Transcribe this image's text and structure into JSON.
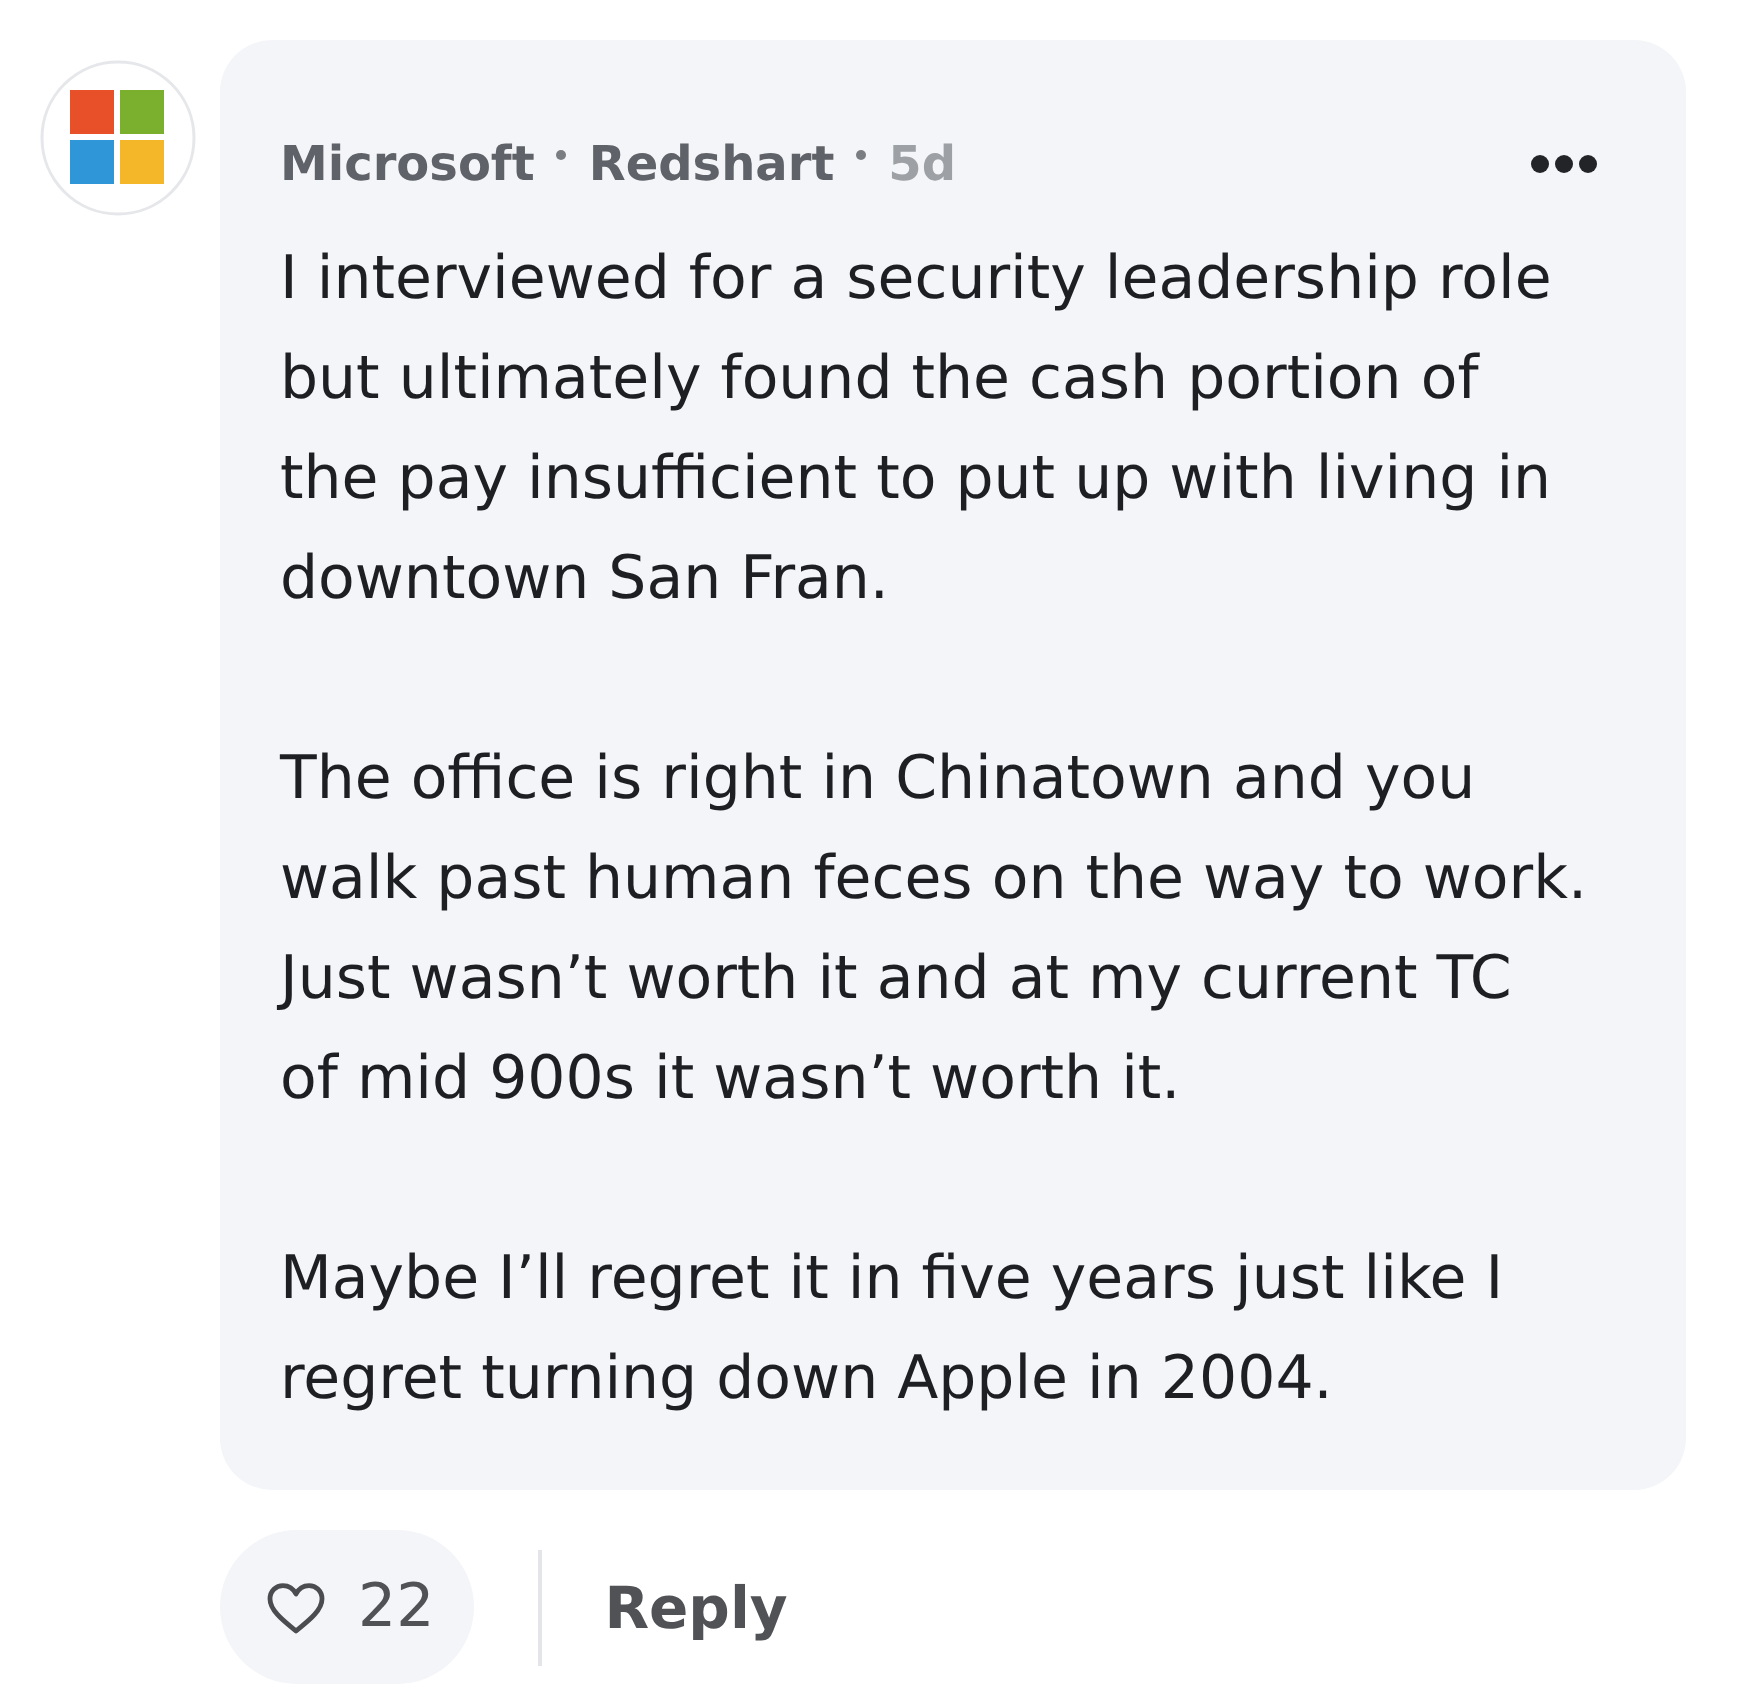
{
  "comment": {
    "author": {
      "company": "Microsoft",
      "username": "Redshart",
      "age": "5d"
    },
    "paragraphs": [
      [
        "I interviewed for a security leadership role",
        "but ultimately found the cash portion of",
        "the pay insufficient to put up with living in",
        "downtown San Fran."
      ],
      [
        "The office is right in Chinatown and you",
        "walk past human feces on the way to work.",
        "Just wasn’t worth it and at my current TC",
        "of mid 900s it wasn’t worth it."
      ],
      [
        "Maybe I’ll regret it in five years just like I",
        "regret turning down Apple in 2004."
      ]
    ]
  },
  "actions": {
    "like": {
      "count": "22",
      "liked": false
    },
    "reply": "Reply"
  }
}
